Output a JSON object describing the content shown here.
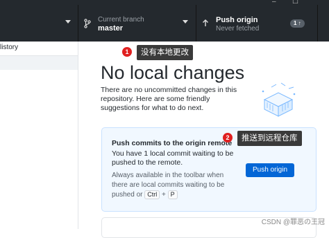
{
  "window": {
    "controls": [
      "–",
      "☐"
    ]
  },
  "toolbar": {
    "branch": {
      "label": "Current branch",
      "value": "master",
      "icon": "branch-icon"
    },
    "push": {
      "label": "Push origin",
      "status": "Never fetched",
      "badge": "1 ↑",
      "icon": "arrow-up-icon"
    }
  },
  "sidebar": {
    "tab_label": "listory"
  },
  "main": {
    "heading": "No local changes",
    "description": "There are no uncommitted changes in this repository. Here are some friendly suggestions for what to do next.",
    "card": {
      "title": "Push commits to the origin remote",
      "body": "You have 1 local commit waiting to be pushed to the remote.",
      "hint_prefix": "Always available in the toolbar when there are local commits waiting to be pushed or",
      "kbd_ctrl": "Ctrl",
      "kbd_plus": "+",
      "kbd_key": "P",
      "button": "Push origin"
    }
  },
  "annotations": [
    {
      "number": "1",
      "text": "没有本地更改"
    },
    {
      "number": "2",
      "text": "推送到远程仓库"
    }
  ],
  "watermark": "CSDN @罪恶の王冠",
  "colors": {
    "toolbar_bg": "#24292e",
    "accent": "#0366d6",
    "card_bg": "#f1f8ff",
    "annotation_red": "#e02020"
  }
}
